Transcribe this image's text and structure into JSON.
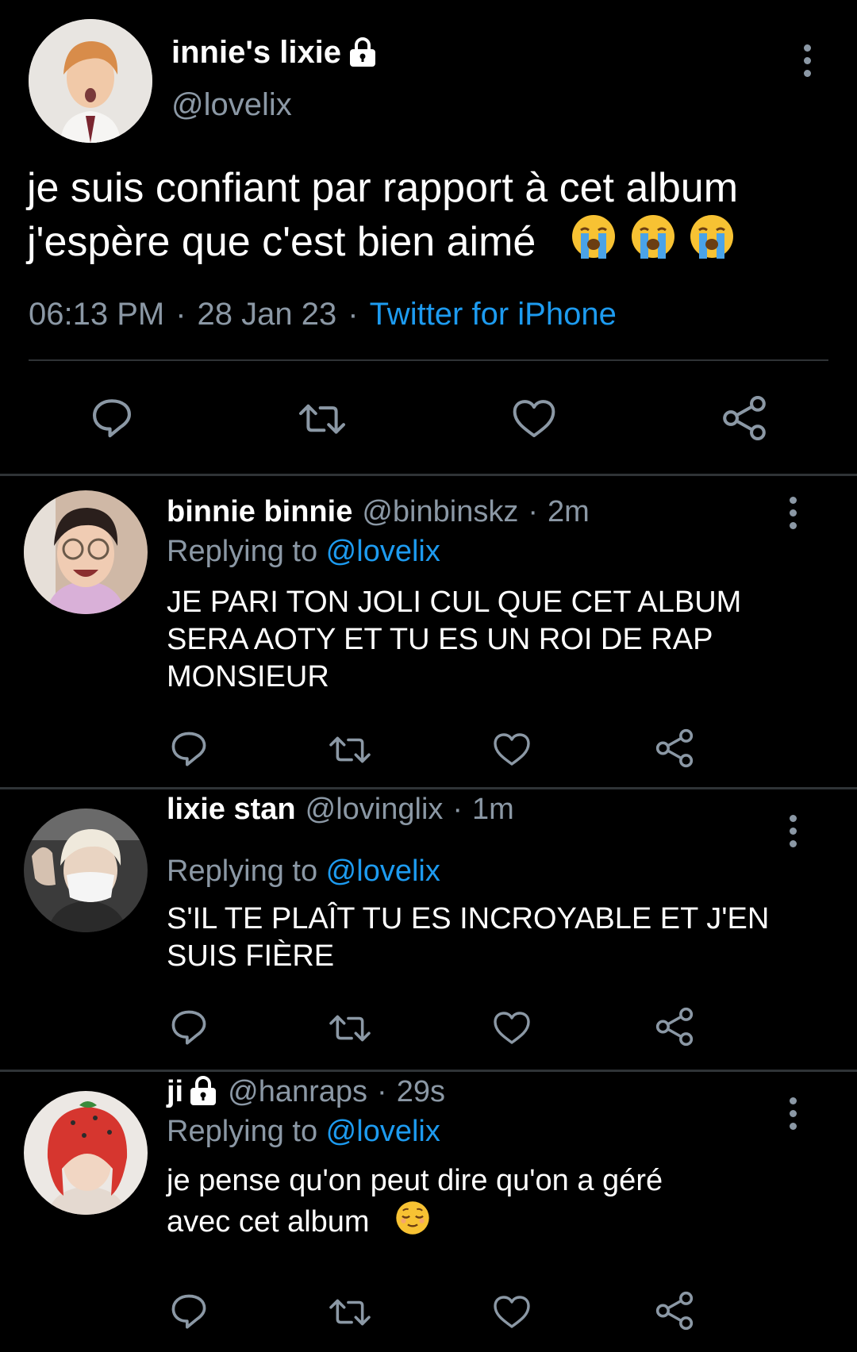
{
  "main_tweet": {
    "display_name": "innie's lixie",
    "handle": "@lovelix",
    "text_line1": "je suis confiant par rapport à cet album",
    "text_line2": "j'espère que c'est bien aimé",
    "time": "06:13 PM",
    "date": "28 Jan 23",
    "source": "Twitter for iPhone",
    "separator": "·",
    "icons": [
      "lock-icon",
      "more-icon",
      "reply-icon",
      "retweet-icon",
      "like-icon",
      "share-icon",
      "loudly-crying-face-emoji"
    ]
  },
  "replies": [
    {
      "display_name": "binnie binnie",
      "handle": "@binbinskz",
      "separator": "·",
      "time": "2m",
      "replying_prefix": "Replying to ",
      "replying_to": "@lovelix",
      "text_lines": [
        "JE PARI TON JOLI CUL QUE CET ALBUM",
        "SERA AOTY ET TU ES UN ROI DE RAP",
        "MONSIEUR"
      ]
    },
    {
      "display_name": "lixie stan",
      "handle": "@lovinglix",
      "separator": "·",
      "time": "1m",
      "replying_prefix": "Replying to ",
      "replying_to": "@lovelix",
      "text_lines": [
        "S'IL TE PLAÎT TU ES INCROYABLE ET J'EN",
        "SUIS FIÈRE"
      ]
    },
    {
      "display_name": "ji",
      "handle": "@hanraps",
      "separator": "·",
      "time": "29s",
      "replying_prefix": "Replying to ",
      "replying_to": "@lovelix",
      "text_lines": [
        "je pense qu'on peut dire qu'on a géré",
        "avec cet album"
      ],
      "icons": [
        "lock-icon",
        "relieved-face-emoji"
      ]
    }
  ],
  "colors": {
    "background": "#000000",
    "text": "#ffffff",
    "secondary_text": "#8b98a5",
    "link": "#1d9bf0",
    "divider": "#2f3336"
  }
}
